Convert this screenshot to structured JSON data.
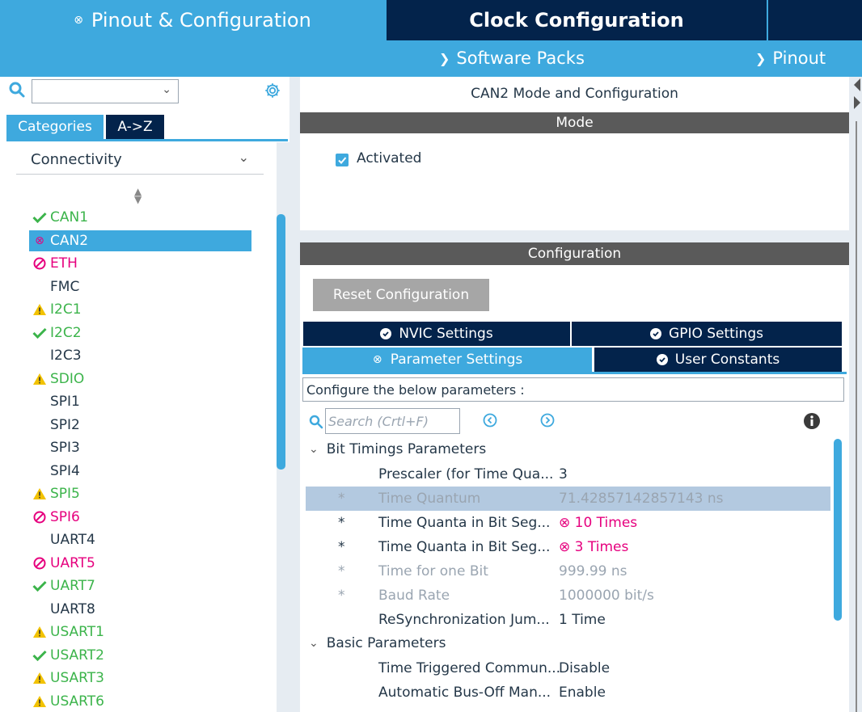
{
  "top_tabs": {
    "pinout": "Pinout & Configuration",
    "clock": "Clock Configuration"
  },
  "sub_menu": {
    "software_packs": "Software Packs",
    "pinout": "Pinout"
  },
  "left": {
    "tabs": {
      "categories": "Categories",
      "az": "A->Z"
    },
    "category": "Connectivity",
    "peripherals": [
      {
        "label": "CAN1",
        "status": "ok"
      },
      {
        "label": "CAN2",
        "status": "error",
        "selected": true
      },
      {
        "label": "ETH",
        "status": "blocked"
      },
      {
        "label": "FMC",
        "status": "none"
      },
      {
        "label": "I2C1",
        "status": "warning"
      },
      {
        "label": "I2C2",
        "status": "ok"
      },
      {
        "label": "I2C3",
        "status": "none"
      },
      {
        "label": "SDIO",
        "status": "warning"
      },
      {
        "label": "SPI1",
        "status": "none"
      },
      {
        "label": "SPI2",
        "status": "none"
      },
      {
        "label": "SPI3",
        "status": "none"
      },
      {
        "label": "SPI4",
        "status": "none"
      },
      {
        "label": "SPI5",
        "status": "warning"
      },
      {
        "label": "SPI6",
        "status": "blocked"
      },
      {
        "label": "UART4",
        "status": "none"
      },
      {
        "label": "UART5",
        "status": "blocked"
      },
      {
        "label": "UART7",
        "status": "ok"
      },
      {
        "label": "UART8",
        "status": "none"
      },
      {
        "label": "USART1",
        "status": "warning"
      },
      {
        "label": "USART2",
        "status": "ok"
      },
      {
        "label": "USART3",
        "status": "warning"
      },
      {
        "label": "USART6",
        "status": "warning"
      }
    ]
  },
  "mode": {
    "title": "CAN2 Mode and Configuration",
    "bar": "Mode",
    "activated_label": "Activated",
    "activated": true
  },
  "config": {
    "bar": "Configuration",
    "reset_button": "Reset Configuration",
    "tabs": {
      "nvic": "NVIC Settings",
      "gpio": "GPIO Settings",
      "parameter": "Parameter Settings",
      "user_constants": "User Constants"
    },
    "describe": "Configure the below parameters :",
    "search_placeholder": "Search (Crtl+F)",
    "groups": {
      "bit_timings": "Bit Timings Parameters",
      "basic": "Basic Parameters"
    },
    "rows": [
      {
        "star": "",
        "name": "Prescaler (for Time Qua...",
        "value": "3"
      },
      {
        "star": "*",
        "name": "Time Quantum",
        "value": "71.42857142857143 ns"
      },
      {
        "star": "*",
        "name": "Time Quanta in Bit Seg...",
        "value": "⊗ 10 Times"
      },
      {
        "star": "*",
        "name": "Time Quanta in Bit Seg...",
        "value": "⊗ 3 Times"
      },
      {
        "star": "*",
        "name": "Time for one Bit",
        "value": "999.99 ns"
      },
      {
        "star": "*",
        "name": "Baud Rate",
        "value": "1000000 bit/s"
      },
      {
        "star": "",
        "name": "ReSynchronization Jum...",
        "value": "1 Time"
      },
      {
        "star": "",
        "name": "Time Triggered Commun...",
        "value": "Disable"
      },
      {
        "star": "",
        "name": "Automatic Bus-Off Man...",
        "value": "Enable"
      }
    ]
  },
  "colors": {
    "accent": "#3ea9de",
    "navy": "#03234b",
    "ok": "#3cb44b",
    "error": "#e6007e",
    "warning": "#f2c200"
  }
}
